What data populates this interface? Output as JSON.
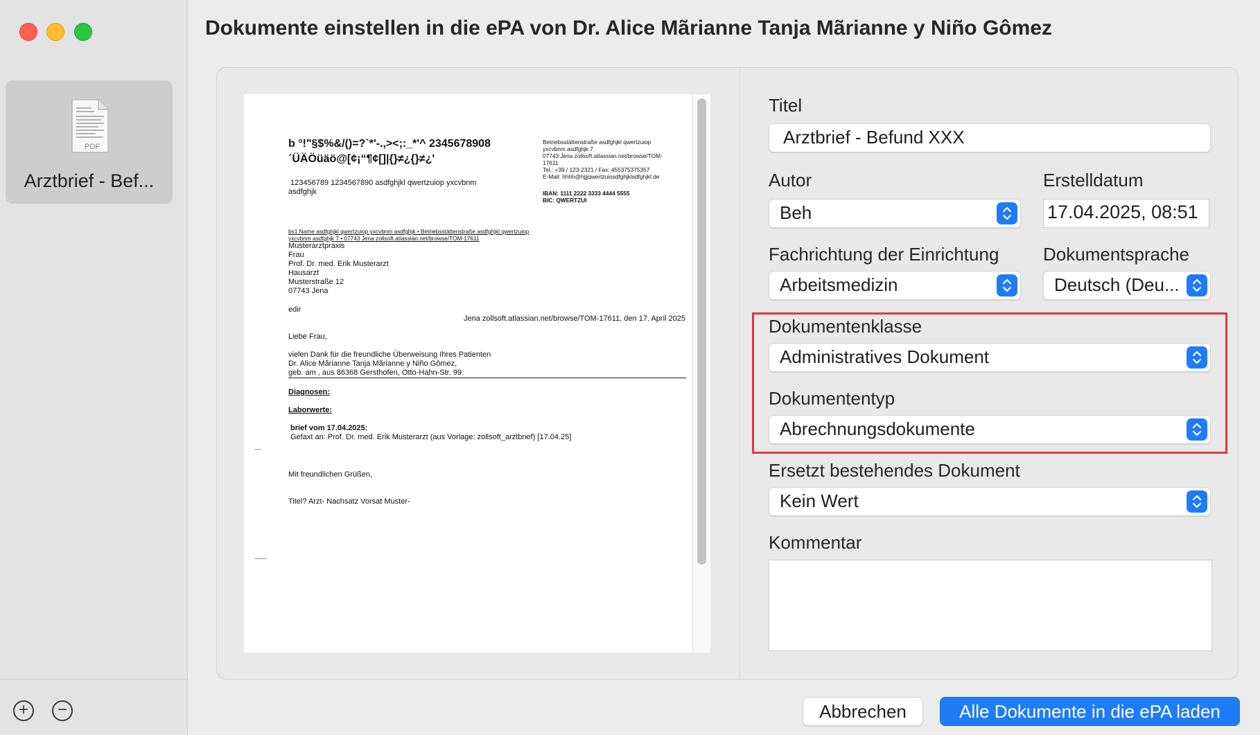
{
  "window": {
    "title": "Dokumente einstellen in die ePA von Dr. Alice Mãrianne Tanja Mãrianne y Niño Gômez"
  },
  "sidebar": {
    "document_tile_label": "Arztbrief - Bef...",
    "pdf_icon_label": "PDF",
    "add_symbol": "+",
    "remove_symbol": "−"
  },
  "preview": {
    "header_line1": "b °!\"§$%&/()=?`*'-.,><;:_*'^ 2345678908",
    "header_line2": "´ÜÄÖüäö@[¢¡“¶¢[]|{}≠¿{}≠¿'",
    "header_line3": "123456789 1234567890 asdfghjkl qwertzuiop yxcvbnm",
    "header_line4": "asdfghjk",
    "address_block": [
      "Betriebsstättenstraße  asdfghjkl qwertzuiop",
      "yxcvbnm asdfghjk 7",
      "07743 Jena zollsoft.atlassian.net/browse/TOM-",
      "17611",
      "Tel.: +39 / 123-2321 / Fax: 455375375357",
      "E-Mail: hhhh@hjjjqwertzuiosdfghjklsdfghjkl.de"
    ],
    "iban": "IBAN: 1111 2222 3333 4444 5555",
    "bic": "BIC: QWERTZUI",
    "sender_line1": "bs1 Name asdfghjkl qwertzuiop yxcvbnm asdfghjk • Betriebsstättenstraße  asdfghjkl qwertzuiop",
    "sender_line2": "yxcvbnm asdfghjk 7 • 07743 Jena zollsoft.atlassian.net/browse/TOM-17611",
    "recipient": [
      "Musterarztpraxis",
      "Frau",
      "Prof. Dr. med. Erik Musterarzt",
      "Hausarzt",
      "Musterstraße 12",
      "07743 Jena"
    ],
    "edir": "edir",
    "place_date": "Jena zollsoft.atlassian.net/browse/TOM-17611, den 17. April 2025",
    "greeting": "Liebe Frau,",
    "body_lines": [
      "vielen Dank für die freundliche Überweisung Ihres Patienten",
      " Dr. Alice Mãrianne Tanja Mãrianne y Niño Gômez,",
      "geb. am , aus 86368 Gersthofen, Otto-Hahn-Str. 99."
    ],
    "diagnosen": "Diagnosen:",
    "laborwerte": "Laborwerte:",
    "brief_line": "brief vom 17.04.2025:",
    "gefaxt_line": "Gefaxt an:  Prof. Dr. med. Erik Musterarzt (aus Vorlage: zollsoft_arztbrief) [17.04.25]",
    "closing": "Mit freundlichen Grüßen,",
    "titel_line": "Titel? Arzt- Nachsatz Vorsat Muster-"
  },
  "form": {
    "titel": {
      "label": "Titel",
      "value": "Arztbrief - Befund XXX"
    },
    "autor": {
      "label": "Autor",
      "value": "Beh"
    },
    "erstelldatum": {
      "label": "Erstelldatum",
      "value": "17.04.2025, 08:51"
    },
    "fachrichtung": {
      "label": "Fachrichtung der Einrichtung",
      "value": "Arbeitsmedizin"
    },
    "dokumentsprache": {
      "label": "Dokumentsprache",
      "value": "Deutsch (Deu..."
    },
    "dokumentenklasse": {
      "label": "Dokumentenklasse",
      "value": "Administratives Dokument"
    },
    "dokumententyp": {
      "label": "Dokumententyp",
      "value": "Abrechnungsdokumente"
    },
    "ersetzt": {
      "label": "Ersetzt bestehendes Dokument",
      "value": "Kein Wert"
    },
    "kommentar": {
      "label": "Kommentar",
      "value": ""
    }
  },
  "buttons": {
    "cancel": "Abbrechen",
    "submit": "Alle Dokumente in die ePA laden"
  },
  "colors": {
    "accent": "#1f7cf6",
    "highlight": "#e0383e"
  }
}
